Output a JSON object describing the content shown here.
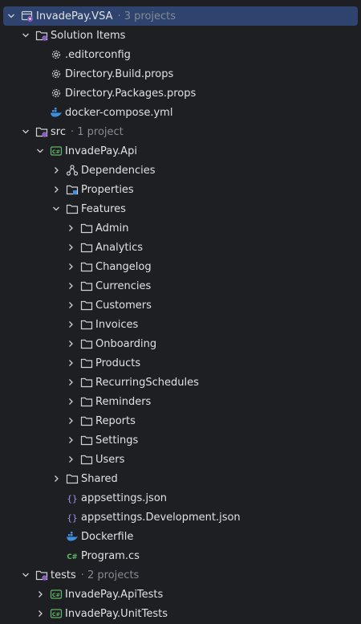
{
  "tree": {
    "solution": {
      "label": "InvadePay.VSA",
      "hint": "· 3 projects",
      "icon": "solution-icon"
    },
    "solution_items": {
      "label": "Solution Items",
      "children": [
        {
          "label": ".editorconfig",
          "icon": "gear-icon"
        },
        {
          "label": "Directory.Build.props",
          "icon": "gear-icon"
        },
        {
          "label": "Directory.Packages.props",
          "icon": "gear-icon"
        },
        {
          "label": "docker-compose.yml",
          "icon": "docker-icon"
        }
      ]
    },
    "src": {
      "label": "src",
      "hint": "· 1 project",
      "project": {
        "label": "InvadePay.Api",
        "icon": "csharp-project-icon",
        "dependencies": "Dependencies",
        "properties": "Properties",
        "features": {
          "label": "Features",
          "folders": [
            "Admin",
            "Analytics",
            "Changelog",
            "Currencies",
            "Customers",
            "Invoices",
            "Onboarding",
            "Products",
            "RecurringSchedules",
            "Reminders",
            "Reports",
            "Settings",
            "Users"
          ]
        },
        "shared": "Shared",
        "files": [
          {
            "label": "appsettings.json",
            "icon": "json-icon"
          },
          {
            "label": "appsettings.Development.json",
            "icon": "json-icon"
          },
          {
            "label": "Dockerfile",
            "icon": "docker-icon"
          },
          {
            "label": "Program.cs",
            "icon": "csharp-file-icon"
          }
        ]
      }
    },
    "tests": {
      "label": "tests",
      "hint": "· 2 projects",
      "projects": [
        {
          "label": "InvadePay.ApiTests",
          "icon": "csharp-project-icon"
        },
        {
          "label": "InvadePay.UnitTests",
          "icon": "csharp-project-icon"
        }
      ]
    }
  },
  "colors": {
    "background": "#1e1f22",
    "selection": "#2e436e",
    "text": "#dfe1e5",
    "hint": "#868a91",
    "csharp": "#5fb865",
    "docker": "#3d8fe0",
    "json": "#a58ff4"
  }
}
